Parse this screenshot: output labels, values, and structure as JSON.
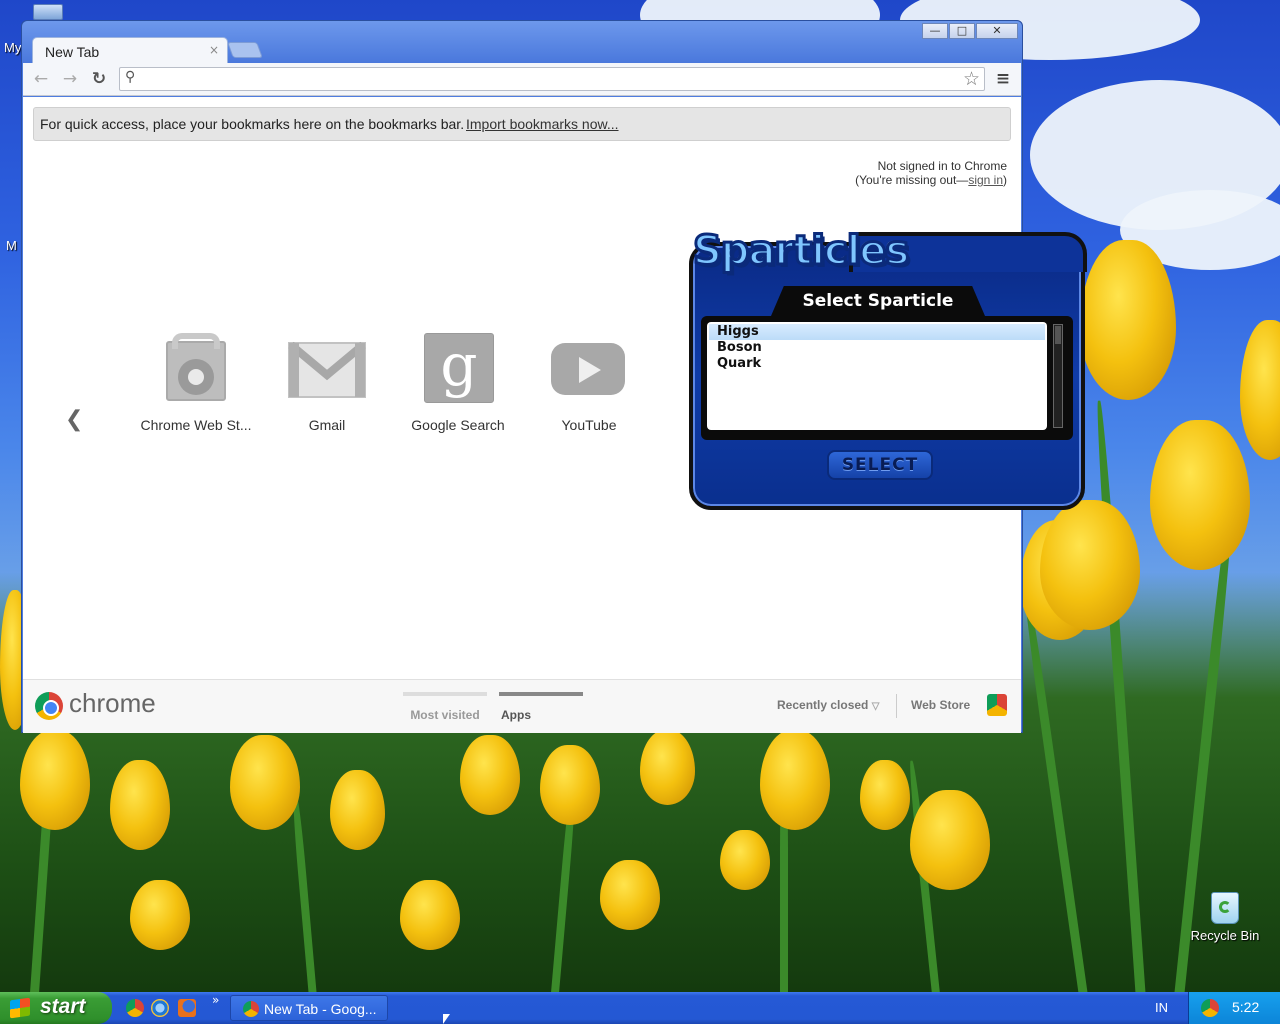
{
  "desktop": {
    "icons": [
      {
        "label": "My",
        "icon": "my-computer-icon"
      },
      {
        "label": "M",
        "icon": "my-documents-icon"
      },
      {
        "label": "Recycle Bin",
        "icon": "recycle-bin-icon"
      }
    ]
  },
  "browser": {
    "tab_title": "New Tab",
    "tab_close": "×",
    "window_buttons": {
      "minimize": "—",
      "maximize": "□",
      "close": "✕"
    },
    "omnibox": {
      "value": "",
      "placeholder": ""
    },
    "bookmarks_bar": {
      "message": "For quick access, place your bookmarks here on the bookmarks bar.",
      "import_link": "Import bookmarks now..."
    },
    "signin": {
      "line1": "Not signed in to Chrome",
      "line2_prefix": "(You're missing out—",
      "link": "sign in",
      "line2_suffix": ")"
    },
    "prev_arrow": "❮",
    "apps": [
      {
        "label": "Chrome Web St...",
        "icon": "chrome-web-store-icon"
      },
      {
        "label": "Gmail",
        "icon": "gmail-icon"
      },
      {
        "label": "Google Search",
        "icon": "google-search-icon"
      },
      {
        "label": "YouTube",
        "icon": "youtube-icon"
      }
    ],
    "footer": {
      "brand": "chrome",
      "tabs": [
        {
          "label": "Most visited",
          "active": false
        },
        {
          "label": "Apps",
          "active": true
        }
      ],
      "recently_closed": "Recently closed",
      "web_store": "Web Store"
    }
  },
  "sparticles": {
    "logo": "Sparticles",
    "title": "Select Sparticle",
    "options": [
      "Higgs",
      "Boson",
      "Quark"
    ],
    "selected": "Higgs",
    "button": "SELECT"
  },
  "taskbar": {
    "start": "start",
    "more": "»",
    "task_label": "New Tab - Goog...",
    "language": "IN",
    "clock": "5:22"
  }
}
